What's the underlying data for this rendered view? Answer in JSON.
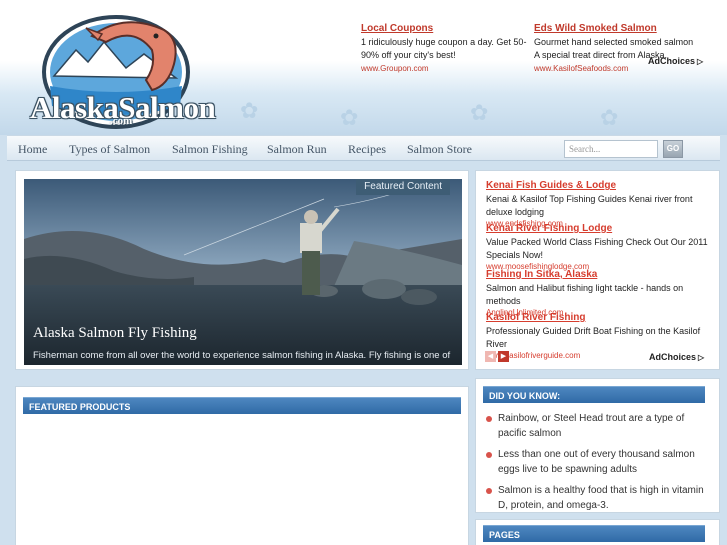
{
  "header": {
    "logo_text": "AlaskaSalmon",
    "logo_subtext": ".com",
    "ads": [
      {
        "title": "Local Coupons",
        "text": "1 ridiculously huge coupon a day. Get 50-90% off your city's best!",
        "url": "www.Groupon.com"
      },
      {
        "title": "Eds Wild Smoked Salmon",
        "text": "Gourmet hand selected smoked salmon A special treat direct from Alaska.",
        "url": "www.KasilofSeafoods.com"
      }
    ],
    "adchoices_label": "AdChoices"
  },
  "nav": {
    "items": [
      "Home",
      "Types of Salmon",
      "Salmon Fishing",
      "Salmon Run",
      "Recipes",
      "Salmon Store"
    ],
    "search_placeholder": "Search...",
    "go_label": "GO"
  },
  "featured": {
    "tag": "Featured Content",
    "title": "Alaska Salmon Fly Fishing",
    "description": "Fisherman come from all over the world to experience salmon fishing in Alaska.  Fly fishing is one of the"
  },
  "products": {
    "heading": "FEATURED PRODUCTS"
  },
  "side_ads": {
    "items": [
      {
        "title": "Kenai Fish Guides & Lodge",
        "text": "Kenai & Kasilof Top Fishing Guides Kenai river front deluxe lodging",
        "url": "www.endsfishing.com"
      },
      {
        "title": "Kenai River Fishing Lodge",
        "text": "Value Packed World Class Fishing Check Out Our 2011 Specials Now!",
        "url": "www.moosefishinglodge.com"
      },
      {
        "title": "Fishing In Sitka, Alaska",
        "text": "Salmon and Halibut fishing light tackle - hands on methods",
        "url": "AnglingUnlimited.com"
      },
      {
        "title": "Kasilof River Fishing",
        "text": "Professionaly Guided Drift Boat Fishing on the Kasilof River",
        "url": "www.kasilofriverguide.com"
      }
    ],
    "adchoices_label": "AdChoices"
  },
  "did_you_know": {
    "heading": "DID YOU KNOW:",
    "facts": [
      "Rainbow, or Steel Head trout are a type of pacific salmon",
      "Less than one out of every thousand salmon eggs live to be spawning adults",
      "Salmon is a healthy food that is high in vitamin D, protein, and omega-3."
    ]
  },
  "pages": {
    "heading": "PAGES"
  },
  "colors": {
    "ad_link": "#c0392b",
    "bar_blue": "#2f6aa6",
    "background": "#cfe0ee"
  }
}
